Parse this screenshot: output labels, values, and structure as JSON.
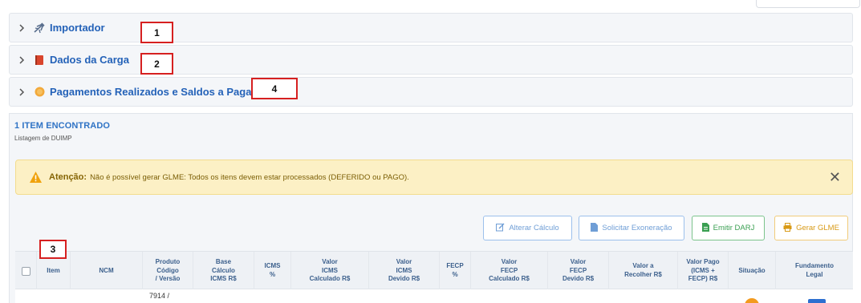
{
  "panels": [
    {
      "label": "Importador",
      "icon": "airplane-icon",
      "marker": "1"
    },
    {
      "label": "Dados da Carga",
      "icon": "book-icon",
      "marker": "2"
    },
    {
      "label": "Pagamentos Realizados e Saldos a Pagar",
      "icon": "coin-icon",
      "marker": "4"
    }
  ],
  "items": {
    "title": "1 ITEM ENCONTRADO",
    "subtitle": "Listagem de DUIMP"
  },
  "alert": {
    "strong": "Atenção:",
    "message": "Não é possível gerar GLME: Todos os itens devem estar processados (DEFERIDO ou PAGO).",
    "close": "✕"
  },
  "actions": {
    "alterar": "Alterar Cálculo",
    "solicitar": "Solicitar Exoneração",
    "emitir": "Emitir DARJ",
    "gerar": "Gerar GLME"
  },
  "marker3": "3",
  "table": {
    "headers": {
      "item": "Item",
      "ncm": "NCM",
      "produto_1": "Produto",
      "produto_2": "Código",
      "produto_3": "/ Versão",
      "base_1": "Base",
      "base_2": "Cálculo",
      "base_3": "ICMS R$",
      "icmsp_1": "ICMS",
      "icmsp_2": "%",
      "vic_1": "Valor",
      "vic_2": "ICMS",
      "vic_3": "Calculado R$",
      "vid_1": "Valor",
      "vid_2": "ICMS",
      "vid_3": "Devido R$",
      "fecp_1": "FECP",
      "fecp_2": "%",
      "vfc_1": "Valor",
      "vfc_2": "FECP",
      "vfc_3": "Calculado R$",
      "vfd_1": "Valor",
      "vfd_2": "FECP",
      "vfd_3": "Devido R$",
      "rec_1": "Valor a",
      "rec_2": "Recolher R$",
      "pago_1": "Valor Pago",
      "pago_2": "(ICMS +",
      "pago_3": "FECP) R$",
      "situacao": "Situação",
      "fund_1": "Fundamento",
      "fund_2": "Legal"
    },
    "row": {
      "produto": "7914 /"
    }
  },
  "colors": {
    "accent": "#2462b8",
    "marker_border": "#d62020",
    "alert_bg": "#fcf0c5",
    "status_orange": "#f39a1e"
  }
}
